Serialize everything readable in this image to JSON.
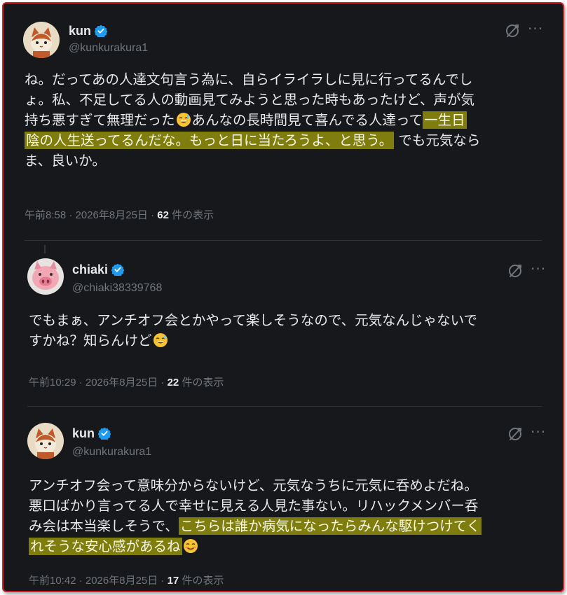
{
  "tweets": [
    {
      "name": "kun",
      "handle": "@kunkurakura1",
      "lines": [
        {
          "pre": "ね。だってあの人達文句言う為に、自らイライラしに見に行ってるんでし"
        },
        {
          "pre": "ょ。私、不足してる人の動画見てみようと思った時もあったけど、声が気"
        },
        {
          "pre": "持ち悪すぎて無理だった",
          "emoji": "sweat-smile",
          "mid": "あんなの長時間見て喜んでる人達って",
          "hl": "一生日"
        },
        {
          "hl": "陰の人生送ってるんだな。もっと日に当たろうよ、と思う。",
          "post": " でも元気なら"
        },
        {
          "pre": "ま、良いか。"
        }
      ],
      "time": "午前8:58 · 2026年8月25日 · ",
      "views": "62",
      "views_suffix": " 件の表示"
    },
    {
      "name": "chiaki",
      "handle": "@chiaki38339768",
      "lines": [
        {
          "pre": "でもまぁ、アンチオフ会とかやって楽しそうなので、元気なんじゃないで"
        },
        {
          "pre": "すかね？知らんけど",
          "emoji": "sweat-smile"
        }
      ],
      "time": "午前10:29 · 2026年8月25日 · ",
      "views": "22",
      "views_suffix": " 件の表示"
    },
    {
      "name": "kun",
      "handle": "@kunkurakura1",
      "lines": [
        {
          "pre": "アンチオフ会って意味分からないけど、元気なうちに元気に呑めよだね。"
        },
        {
          "pre": "悪口ばかり言ってる人で幸せに見える人見た事ない。リハックメンバー呑"
        },
        {
          "pre": "み会は本当楽しそうで、",
          "hl": "こちらは誰か病気になったらみんな駆けつけてく"
        },
        {
          "hl": "れそうな安心感があるね",
          "emoji": "smile"
        }
      ],
      "time": "午前10:42 · 2026年8月25日 · ",
      "views": "17",
      "views_suffix": " 件の表示"
    }
  ],
  "icons": {
    "verified": "verified-badge-icon",
    "grok": "grok-icon",
    "more": "more-icon"
  },
  "colors": {
    "background": "#16181c",
    "text": "#e7e9ea",
    "muted": "#71767b",
    "highlight": "#7f7d0e",
    "verified": "#1d9bf0",
    "frame_border": "#d4202a"
  }
}
